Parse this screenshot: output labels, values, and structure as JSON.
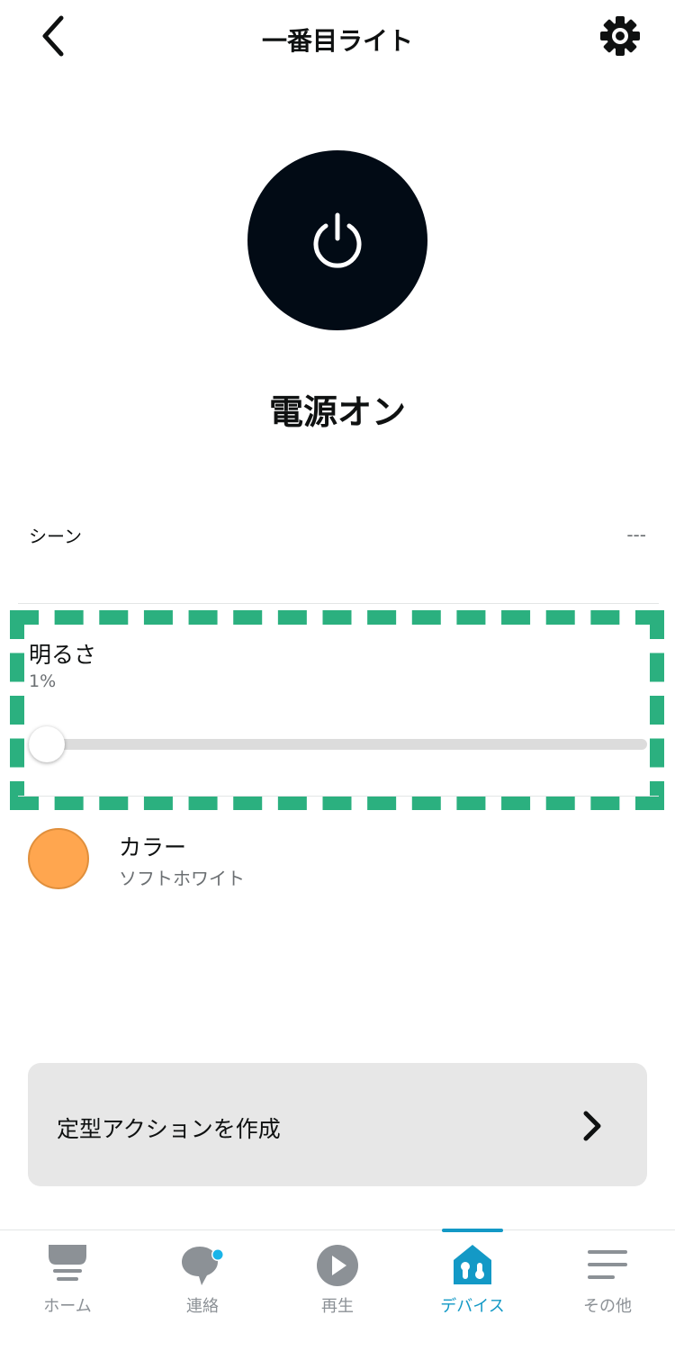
{
  "header": {
    "title": "一番目ライト",
    "back_icon": "chevron-left-icon",
    "settings_icon": "gear-icon"
  },
  "power": {
    "icon": "power-icon",
    "status": "電源オン"
  },
  "scene": {
    "label": "シーン",
    "value": "---"
  },
  "brightness": {
    "label": "明るさ",
    "value_text": "1%",
    "level": 0.01
  },
  "color": {
    "label": "カラー",
    "value": "ソフトホワイト",
    "swatch": "#ffa64f"
  },
  "routine": {
    "label": "定型アクションを作成",
    "icon": "chevron-right-icon"
  },
  "nav": {
    "items": [
      {
        "label": "ホーム",
        "icon": "home-icon",
        "active": false
      },
      {
        "label": "連絡",
        "icon": "chat-icon",
        "active": false
      },
      {
        "label": "再生",
        "icon": "play-icon",
        "active": false
      },
      {
        "label": "デバイス",
        "icon": "devices-icon",
        "active": true
      },
      {
        "label": "その他",
        "icon": "menu-icon",
        "active": false
      }
    ]
  },
  "colors": {
    "accent": "#1399c6",
    "highlight": "#2bb07f",
    "power_button": "#020b15",
    "notification_dot": "#1ab4e8"
  }
}
